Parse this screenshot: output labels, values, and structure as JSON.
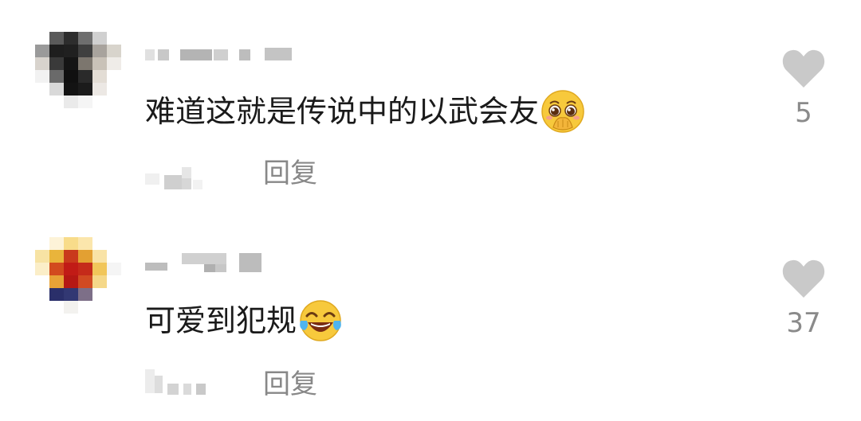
{
  "comments": [
    {
      "text": "难道这就是传说中的以武会友",
      "emoji": "pleading-face-hands-over-mouth-emoji",
      "reply_label": "回复",
      "like_count": "5"
    },
    {
      "text": "可爱到犯规",
      "emoji": "rolling-laughing-tears-emoji",
      "reply_label": "回复",
      "like_count": "37"
    }
  ],
  "icons": {
    "like": "heart-icon"
  },
  "colors": {
    "text": "#1a1a1a",
    "secondary": "#888888",
    "heart": "#c9c9c9",
    "emoji": "#f7c93c"
  }
}
